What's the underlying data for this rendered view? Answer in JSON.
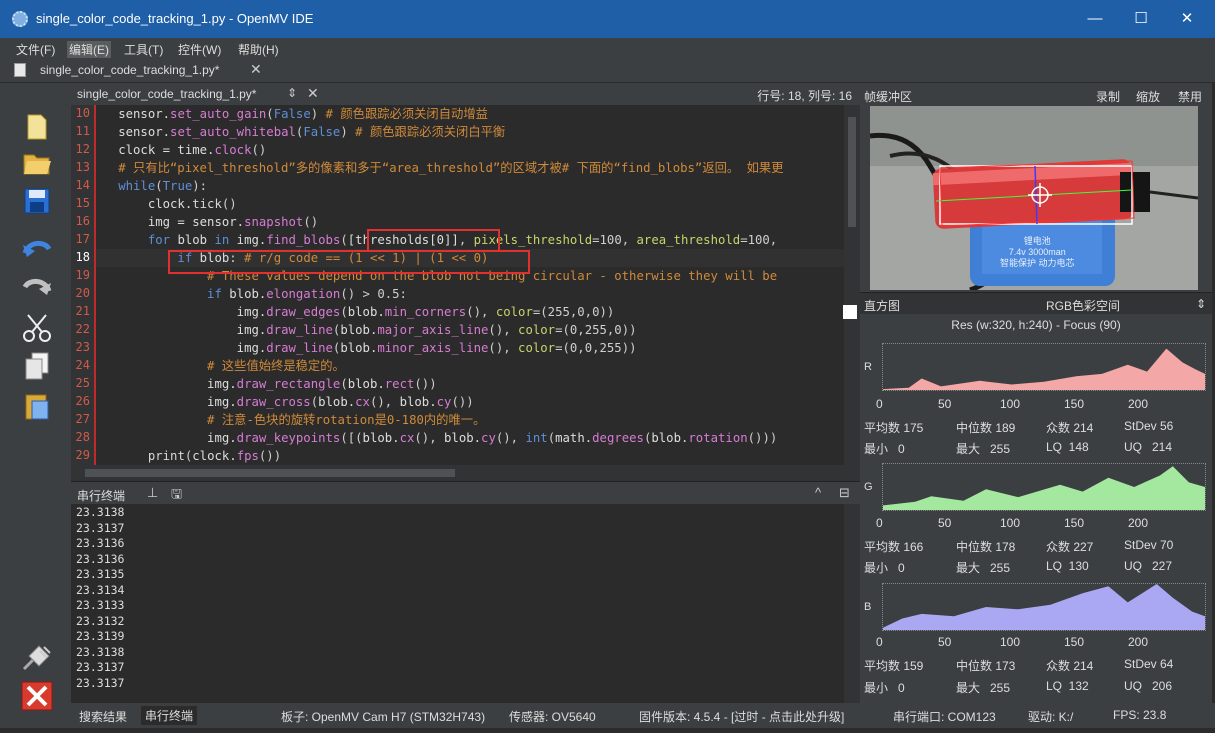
{
  "window": {
    "title": "single_color_code_tracking_1.py - OpenMV IDE",
    "minimize": "—",
    "maximize": "☐",
    "close": "✕"
  },
  "menu": [
    "文件(F)",
    "编辑(E)",
    "工具(T)",
    "控件(W)",
    "帮助(H)"
  ],
  "file_tab": {
    "name": "single_color_code_tracking_1.py*",
    "close": "✕"
  },
  "editor": {
    "doc_name": "single_color_code_tracking_1.py*",
    "position": "行号: 18, 列号: 16",
    "current_line": 18,
    "line_numbers": [
      "10",
      "11",
      "12",
      "13",
      "14",
      "15",
      "16",
      "17",
      "18",
      "19",
      "20",
      "21",
      "22",
      "23",
      "24",
      "25",
      "26",
      "27",
      "28",
      "29"
    ]
  },
  "terminal": {
    "label": "串行终端",
    "values": [
      "23.3138",
      "23.3137",
      "23.3136",
      "23.3136",
      "23.3135",
      "23.3134",
      "23.3133",
      "23.3132",
      "23.3139",
      "23.3138",
      "23.3137",
      "23.3137"
    ]
  },
  "statusbar": {
    "search": "搜索结果",
    "terminal": "串行终端",
    "board": "板子: OpenMV Cam H7 (STM32H743)",
    "sensor": "传感器: OV5640",
    "firmware": "固件版本: 4.5.4 - [过时 - 点击此处升级]",
    "port": "串行端口: COM123",
    "drive": "驱动: K:/",
    "fps": "FPS: 23.8"
  },
  "framebuffer": {
    "label": "帧缓冲区",
    "record": "录制",
    "zoom": "缩放",
    "disable": "禁用",
    "battery_line1": "锂电池",
    "battery_line2": "7.4v 3000man",
    "battery_line3": "智能保护 动力电芯"
  },
  "histogram": {
    "label": "直方图",
    "colorspace": "RGB色彩空间",
    "resolution": "Res (w:320, h:240) - Focus (90)",
    "axis_ticks": [
      "0",
      "50",
      "100",
      "150",
      "200"
    ],
    "channels": [
      {
        "name": "R",
        "color": "#f4a7a7",
        "mean": "平均数 175",
        "median": "中位数 189",
        "mode": "众数 214",
        "stdev": "StDev 56",
        "min": "最小   0",
        "max": "最大   255",
        "lq": "LQ  148",
        "uq": "UQ   214"
      },
      {
        "name": "G",
        "color": "#a4e8a0",
        "mean": "平均数 166",
        "median": "中位数 178",
        "mode": "众数 227",
        "stdev": "StDev 70",
        "min": "最小   0",
        "max": "最大   255",
        "lq": "LQ  130",
        "uq": "UQ   227"
      },
      {
        "name": "B",
        "color": "#aaa8f2",
        "mean": "平均数 159",
        "median": "中位数 173",
        "mode": "众数 214",
        "stdev": "StDev 64",
        "min": "最小   0",
        "max": "最大   255",
        "lq": "LQ  132",
        "uq": "UQ   206"
      }
    ]
  }
}
